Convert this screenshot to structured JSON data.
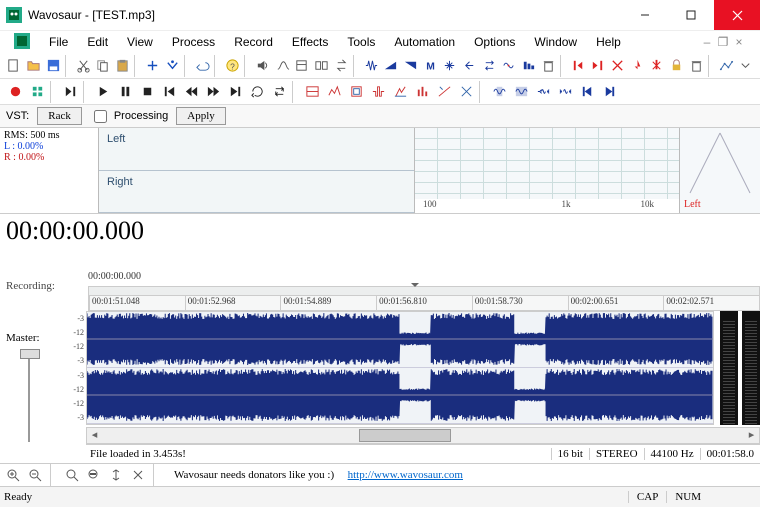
{
  "title": "Wavosaur - [TEST.mp3]",
  "menu": [
    "File",
    "Edit",
    "View",
    "Process",
    "Record",
    "Effects",
    "Tools",
    "Automation",
    "Options",
    "Window",
    "Help"
  ],
  "vst": {
    "label": "VST:",
    "rack": "Rack",
    "processing": "Processing",
    "apply": "Apply"
  },
  "rms": {
    "header": "RMS: 500 ms",
    "L": "L : 0.00%",
    "R": "R : 0.00%"
  },
  "channels": {
    "left": "Left",
    "right": "Right"
  },
  "spectrum_axis": [
    "100",
    "1k",
    "10k"
  ],
  "phase_label": "Left",
  "timecode": "00:00:00.000",
  "recording": "Recording:",
  "current_time": "00:00:00.000",
  "ruler": [
    "00:01:51.048",
    "00:01:52.968",
    "00:01:54.889",
    "00:01:56.810",
    "00:01:58.730",
    "00:02:00.651",
    "00:02:02.571"
  ],
  "master": "Master:",
  "db_ticks": [
    "-3",
    "-12",
    "-12",
    "-3"
  ],
  "info": {
    "msg": "File loaded in 3.453s!",
    "bits": "16 bit",
    "stereo": "STEREO",
    "rate": "44100 Hz",
    "pos": "00:01:58.0"
  },
  "donate": {
    "text": "Wavosaur needs donators like you :)",
    "url": "http://www.wavosaur.com"
  },
  "status": {
    "ready": "Ready",
    "cap": "CAP",
    "num": "NUM"
  }
}
